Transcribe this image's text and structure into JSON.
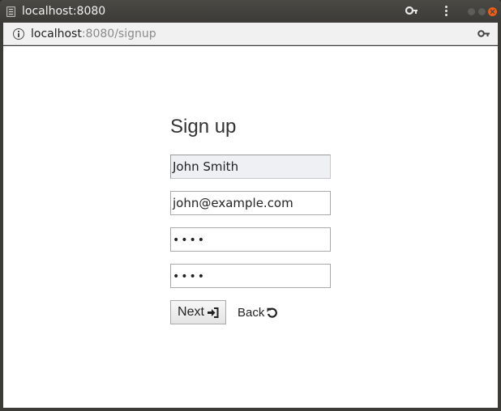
{
  "window": {
    "title": "localhost:8080",
    "icons": [
      "page-icon",
      "key-icon",
      "menu-icon",
      "minimize-icon",
      "maximize-icon",
      "close-icon"
    ]
  },
  "addressbar": {
    "url_host": "localhost",
    "url_rest": ":8080/signup",
    "icons": [
      "info-icon",
      "key-icon"
    ]
  },
  "signup": {
    "heading": "Sign up",
    "name_value": "John Smith",
    "email_value": "john@example.com",
    "password_masked": "••••",
    "confirm_masked": "••••",
    "next_label": "Next",
    "back_label": "Back",
    "icons": [
      "sign-in-icon",
      "undo-icon"
    ]
  },
  "colors": {
    "titlebar": "#3c3b37",
    "close_button": "#e8601c",
    "page_background": "#ffffff"
  }
}
